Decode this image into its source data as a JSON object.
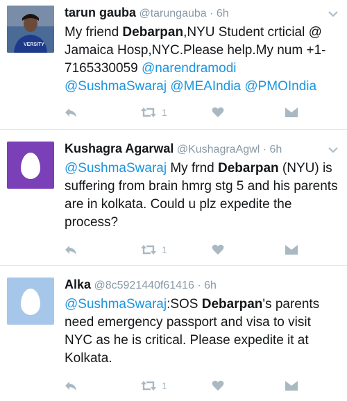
{
  "tweets": [
    {
      "name": "tarun gauba",
      "handle": "@tarungauba",
      "dot": "·",
      "time": "6h",
      "avatar": "photo",
      "text_runs": [
        {
          "t": "My friend ",
          "s": "plain"
        },
        {
          "t": "Debarpan",
          "s": "bold"
        },
        {
          "t": ",NYU Student  crticial @ Jamaica Hosp,NYC.Please help.My num +1-7165330059 ",
          "s": "plain"
        },
        {
          "t": "@narendramodi",
          "s": "mention"
        },
        {
          "t": " ",
          "s": "plain"
        },
        {
          "t": "@SushmaSwaraj",
          "s": "mention"
        },
        {
          "t": " ",
          "s": "plain"
        },
        {
          "t": "@MEAIndia",
          "s": "mention"
        },
        {
          "t": " ",
          "s": "plain"
        },
        {
          "t": "@PMOIndia",
          "s": "mention"
        }
      ],
      "retweet_count": "1"
    },
    {
      "name": "Kushagra Agarwal",
      "handle": "@KushagraAgwl",
      "dot": "·",
      "time": "6h",
      "avatar": "egg-purple",
      "text_runs": [
        {
          "t": "@SushmaSwaraj",
          "s": "mention"
        },
        {
          "t": " My frnd ",
          "s": "plain"
        },
        {
          "t": "Debarpan",
          "s": "bold"
        },
        {
          "t": " (NYU) is suffering from brain hmrg stg 5 and his parents are in kolkata. Could u plz expedite the process?",
          "s": "plain"
        }
      ],
      "retweet_count": "1"
    },
    {
      "name": "Alka",
      "handle": "@8c5921440f61416",
      "dot": "·",
      "time": "6h",
      "avatar": "egg-blue",
      "text_runs": [
        {
          "t": "@SushmaSwaraj",
          "s": "mention"
        },
        {
          "t": ":SOS ",
          "s": "plain"
        },
        {
          "t": "Debarpan",
          "s": "bold"
        },
        {
          "t": "'s parents need emergency passport and visa to visit NYC as he is critical. Please expedite it at Kolkata.",
          "s": "plain"
        }
      ],
      "retweet_count": "1"
    }
  ],
  "icons": {
    "reply": "reply-icon",
    "retweet": "retweet-icon",
    "like": "heart-icon",
    "dm": "envelope-icon",
    "more": "chevron-down-icon"
  },
  "colors": {
    "mention": "#1b95e0",
    "muted": "#8899a6",
    "action_icon": "#aab8c2",
    "divider": "#e1e8ed",
    "egg_purple": "#7b3fb8",
    "egg_blue": "#a7c7ea"
  }
}
